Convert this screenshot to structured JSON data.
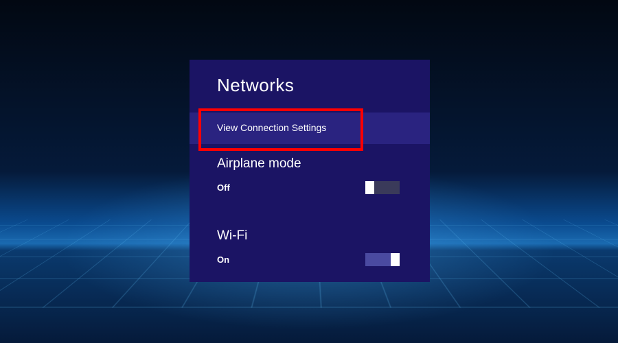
{
  "panel": {
    "title": "Networks",
    "link": "View Connection Settings",
    "airplane": {
      "title": "Airplane mode",
      "status": "Off",
      "on": false
    },
    "wifi": {
      "title": "Wi-Fi",
      "status": "On",
      "on": true
    }
  },
  "highlight": {
    "target": "view-connection-settings-link",
    "color": "#ff0000"
  }
}
